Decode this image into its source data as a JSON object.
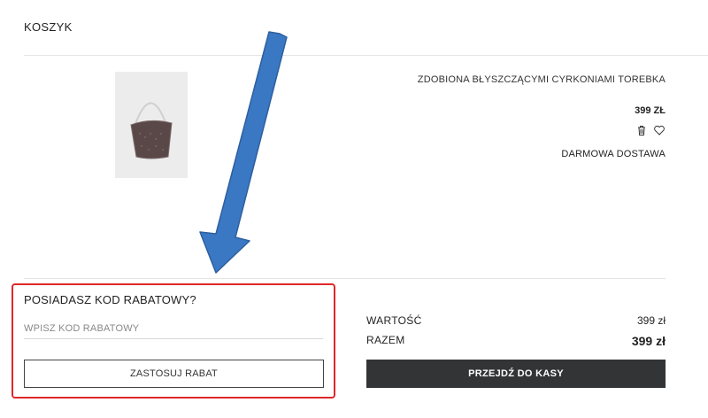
{
  "header": {
    "title": "KOSZYK"
  },
  "product": {
    "name": "ZDOBIONA BŁYSZCZĄCYMI CYRKONIAMI TOREBKA",
    "price": "399 ZŁ",
    "shipping": "DARMOWA DOSTAWA",
    "icons": {
      "delete": "trash-icon",
      "favorite": "heart-icon"
    }
  },
  "discount": {
    "title": "POSIADASZ KOD RABATOWY?",
    "input_value": "",
    "input_placeholder": "WPISZ KOD RABATOWY",
    "apply_label": "ZASTOSUJ RABAT"
  },
  "summary": {
    "value_label": "WARTOŚĆ",
    "value_amount": "399 zł",
    "total_label": "RAZEM",
    "total_amount": "399 zł",
    "checkout_label": "PRZEJDŹ DO KASY"
  },
  "colors": {
    "highlight": "#e0282a",
    "arrow": "#3a78c4",
    "checkout_bg": "#333436"
  }
}
